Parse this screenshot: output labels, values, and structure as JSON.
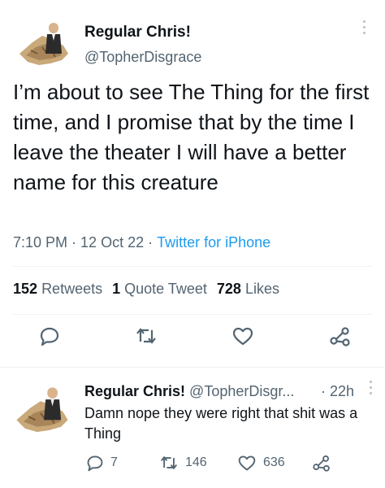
{
  "tweet": {
    "author": {
      "name": "Regular Chris!",
      "handle": "@TopherDisgrace"
    },
    "text": "I’m about to see The Thing for the first time, and I promise that by the time I leave the theater I will have a better name for this creature",
    "time": "7:10 PM",
    "date": "12 Oct 22",
    "source": "Twitter for iPhone",
    "separator": "·",
    "stats": {
      "retweets_count": "152",
      "retweets_label": "Retweets",
      "quotes_count": "1",
      "quotes_label": "Quote Tweet",
      "likes_count": "728",
      "likes_label": "Likes"
    },
    "actions": [
      "reply-icon",
      "retweet-icon",
      "like-icon",
      "share-icon"
    ]
  },
  "reply": {
    "author": {
      "name": "Regular Chris!",
      "handle": "@TopherDisgr..."
    },
    "separator": "·",
    "time": "22h",
    "text": "Damn nope they were right that shit was a Thing",
    "replies": "7",
    "retweets": "146",
    "likes": "636"
  },
  "colors": {
    "accent": "#1d9bf0",
    "secondary_text": "#536471",
    "divider": "#eff3f4"
  }
}
